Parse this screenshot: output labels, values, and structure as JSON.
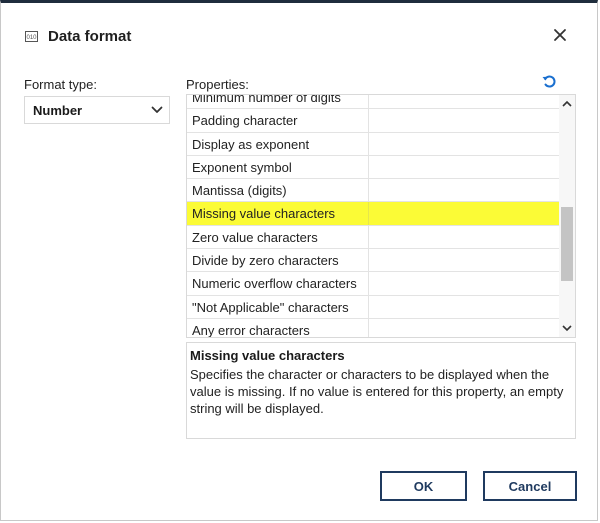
{
  "dialog": {
    "title": "Data format",
    "title_icon": "format-icon",
    "close_icon": "close-icon"
  },
  "format_type": {
    "label": "Format type:",
    "selected": "Number",
    "icon": "chevron-down-icon"
  },
  "properties": {
    "label": "Properties:",
    "reset_icon": "reset-icon",
    "rows": [
      {
        "name": "Minimum number of digits",
        "value": ""
      },
      {
        "name": "Padding character",
        "value": ""
      },
      {
        "name": "Display as exponent",
        "value": ""
      },
      {
        "name": "Exponent symbol",
        "value": ""
      },
      {
        "name": "Mantissa (digits)",
        "value": ""
      },
      {
        "name": "Missing value characters",
        "value": "",
        "highlighted": true
      },
      {
        "name": "Zero value characters",
        "value": ""
      },
      {
        "name": "Divide by zero characters",
        "value": ""
      },
      {
        "name": "Numeric overflow characters",
        "value": ""
      },
      {
        "name": "\"Not Applicable\" characters",
        "value": ""
      },
      {
        "name": "Any error characters",
        "value": ""
      }
    ],
    "highlight_color": "#fbfb36"
  },
  "description": {
    "title": "Missing value characters",
    "text": "Specifies the character or characters to be displayed when the value is missing. If no value is entered for this property, an empty string will be displayed."
  },
  "buttons": {
    "ok": "OK",
    "cancel": "Cancel"
  },
  "colors": {
    "accent": "#1f3a5f",
    "reset_icon": "#1a6fcf"
  }
}
